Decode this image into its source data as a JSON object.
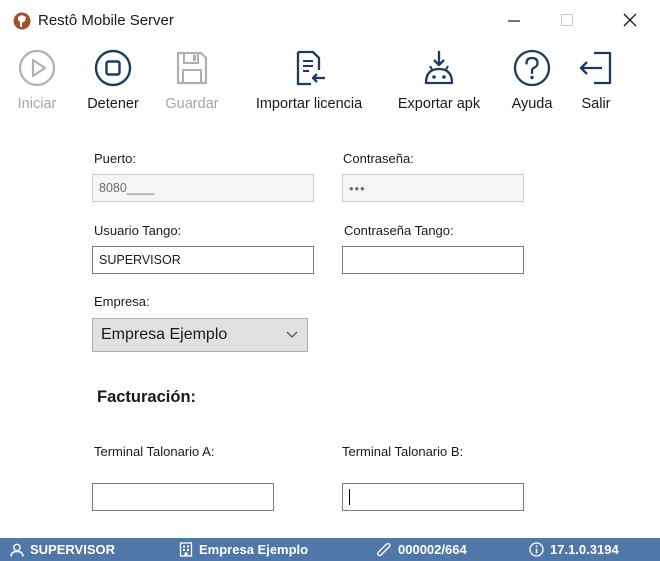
{
  "window": {
    "title": "Restô Mobile Server",
    "controls": {
      "minimize": "minimize-icon",
      "maximize": "maximize-icon",
      "close": "close-icon"
    }
  },
  "toolbar": {
    "iniciar": "Iniciar",
    "detener": "Detener",
    "guardar": "Guardar",
    "importar_licencia": "Importar licencia",
    "exportar_apk": "Exportar apk",
    "ayuda": "Ayuda",
    "salir": "Salir"
  },
  "form": {
    "puerto": {
      "label": "Puerto:",
      "value": "8080____"
    },
    "contrasena": {
      "label": "Contraseña:",
      "value": "•••"
    },
    "usuario_tango": {
      "label": "Usuario Tango:",
      "value": "SUPERVISOR"
    },
    "contrasena_tango": {
      "label": "Contraseña Tango:",
      "value": ""
    },
    "empresa": {
      "label": "Empresa:",
      "selected": "Empresa Ejemplo"
    },
    "facturacion_title": "Facturación:",
    "terminal_a": {
      "label": "Terminal Talonario A:",
      "value": ""
    },
    "terminal_b": {
      "label": "Terminal Talonario B:",
      "value": ""
    }
  },
  "statusbar": {
    "user": "SUPERVISOR",
    "company": "Empresa Ejemplo",
    "license": "000002/664",
    "version": "17.1.0.3194"
  },
  "colors": {
    "statusbar_bg": "#4f77a7",
    "icon_dark": "#1f3a5f",
    "icon_disabled": "#b0b0b0",
    "app_icon": "#a0522d"
  }
}
